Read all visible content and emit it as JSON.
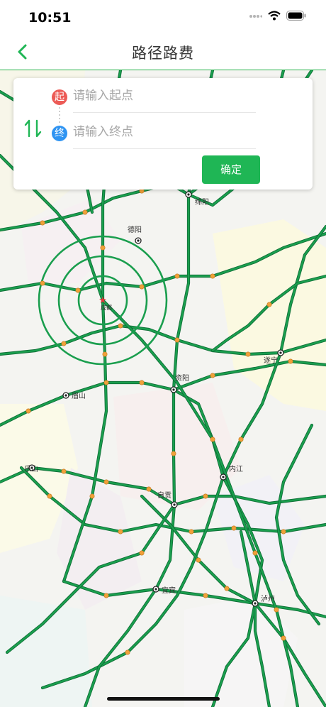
{
  "status": {
    "time": "10:51"
  },
  "nav": {
    "title": "路径路费"
  },
  "route_card": {
    "start_badge": "起",
    "end_badge": "终",
    "start_placeholder": "请输入起点",
    "end_placeholder": "请输入终点",
    "confirm_label": "确定"
  },
  "map": {
    "cities": [
      {
        "id": "mianyang",
        "name": "绵阳",
        "kind": "city"
      },
      {
        "id": "deyang",
        "name": "德阳",
        "kind": "city"
      },
      {
        "id": "chengdu",
        "name": "成都",
        "kind": "capital"
      },
      {
        "id": "suining",
        "name": "遂宁",
        "kind": "city"
      },
      {
        "id": "ziyang",
        "name": "资阳",
        "kind": "city"
      },
      {
        "id": "meishan",
        "name": "眉山",
        "kind": "city"
      },
      {
        "id": "leshan",
        "name": "乐山",
        "kind": "city"
      },
      {
        "id": "neijiang",
        "name": "内江",
        "kind": "city"
      },
      {
        "id": "zigong",
        "name": "自贡",
        "kind": "city"
      },
      {
        "id": "yibin",
        "name": "宜宾",
        "kind": "city"
      },
      {
        "id": "luzhou",
        "name": "泸州",
        "kind": "city"
      }
    ]
  },
  "colors": {
    "accent": "#1fb655",
    "road": "#1a9e4e",
    "road_casing": "#0d6b34",
    "toll_node": "#f0a13a"
  }
}
